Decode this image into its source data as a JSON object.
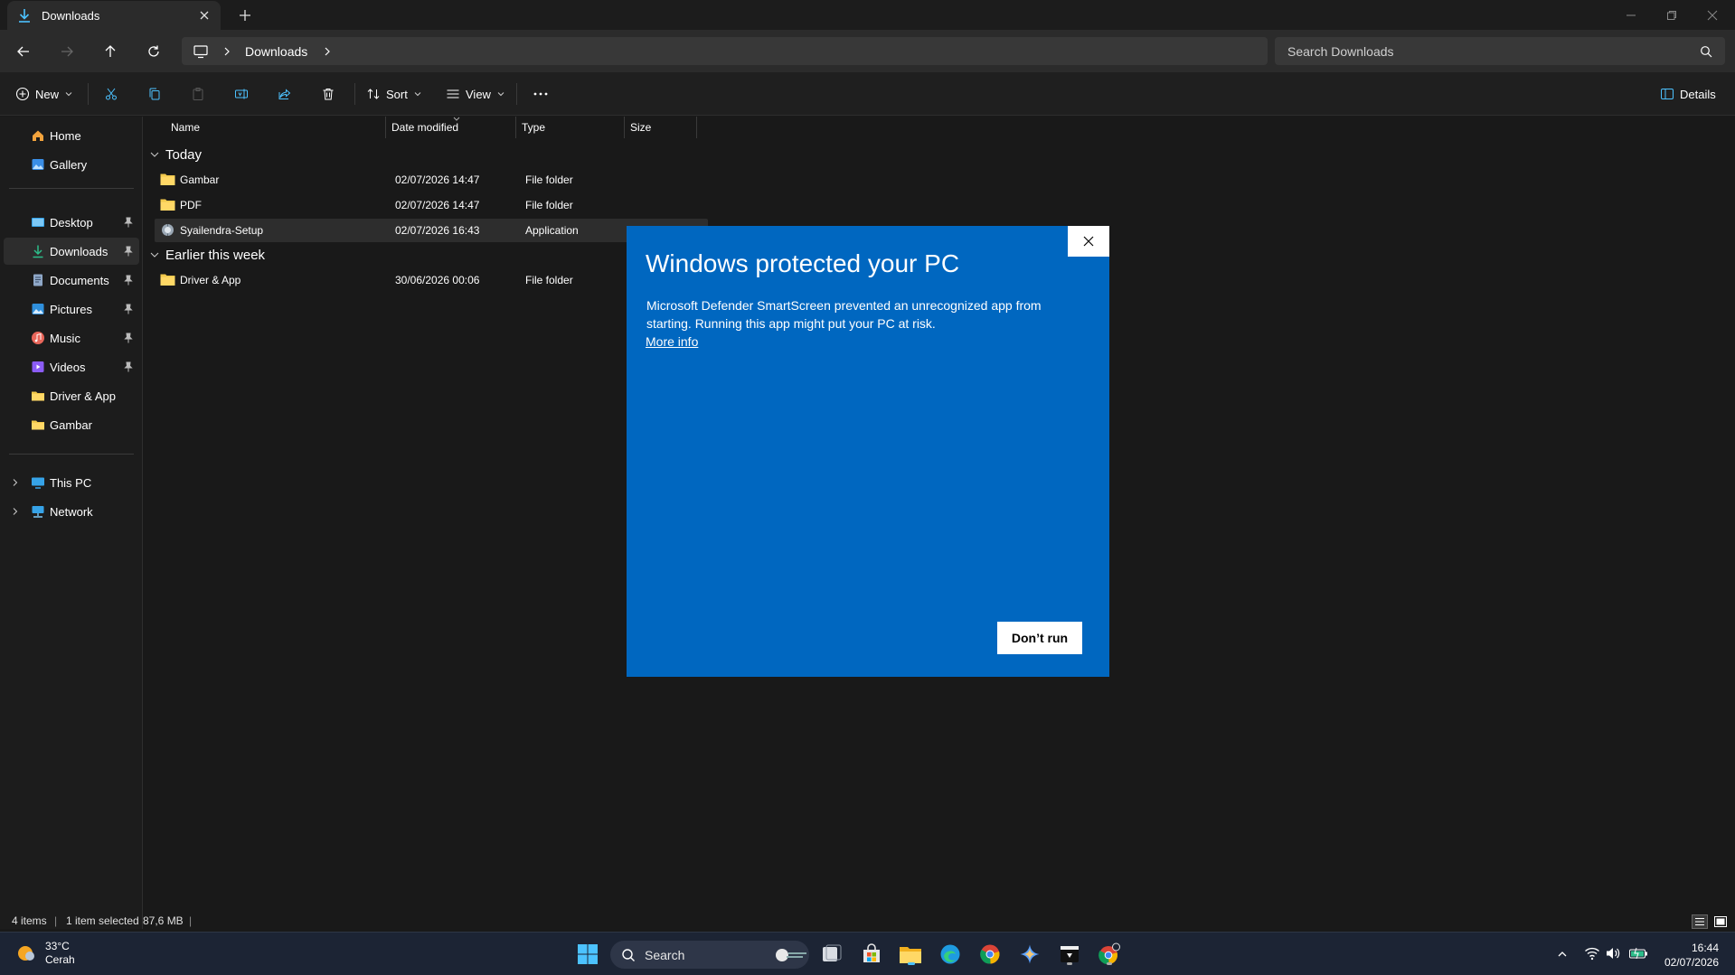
{
  "window": {
    "tab_title": "Downloads",
    "new_tab_symbol": "+",
    "controls": [
      "minimize-icon",
      "restore-icon",
      "close-icon"
    ]
  },
  "address": {
    "crumbs": [
      "Downloads"
    ],
    "search_placeholder": "Search Downloads"
  },
  "toolbar": {
    "new_label": "New",
    "sort_label": "Sort",
    "view_label": "View",
    "details_label": "Details"
  },
  "sidebar": {
    "items": [
      {
        "label": "Home",
        "icon": "home-icon",
        "pinned": false
      },
      {
        "label": "Gallery",
        "icon": "gallery-icon",
        "pinned": false
      },
      {
        "label": "Desktop",
        "icon": "desktop-icon",
        "pinned": true
      },
      {
        "label": "Downloads",
        "icon": "download-icon",
        "pinned": true,
        "selected": true
      },
      {
        "label": "Documents",
        "icon": "documents-icon",
        "pinned": true
      },
      {
        "label": "Pictures",
        "icon": "pictures-icon",
        "pinned": true
      },
      {
        "label": "Music",
        "icon": "music-icon",
        "pinned": true
      },
      {
        "label": "Videos",
        "icon": "videos-icon",
        "pinned": true
      },
      {
        "label": "Driver & App",
        "icon": "folder-icon",
        "pinned": false
      },
      {
        "label": "Gambar",
        "icon": "folder-icon",
        "pinned": false
      }
    ],
    "locations": [
      {
        "label": "This PC",
        "icon": "pc-icon"
      },
      {
        "label": "Network",
        "icon": "network-icon"
      }
    ]
  },
  "columns": [
    "Name",
    "Date modified",
    "Type",
    "Size"
  ],
  "groups": [
    {
      "title": "Today",
      "rows": [
        {
          "name": "Gambar",
          "date": "02/07/2026 14:47",
          "type": "File folder",
          "size": "",
          "icon": "folder-icon"
        },
        {
          "name": "PDF",
          "date": "02/07/2026 14:47",
          "type": "File folder",
          "size": "",
          "icon": "folder-icon"
        },
        {
          "name": "Syailendra-Setup",
          "date": "02/07/2026 16:43",
          "type": "Application",
          "size": "",
          "icon": "setup-app-icon",
          "selected": true
        }
      ]
    },
    {
      "title": "Earlier this week",
      "rows": [
        {
          "name": "Driver & App",
          "date": "30/06/2026 00:06",
          "type": "File folder",
          "size": "",
          "icon": "folder-icon"
        }
      ]
    }
  ],
  "status": {
    "count": "4 items",
    "selected": "1 item selected",
    "size": "87,6 MB"
  },
  "dialog": {
    "title": "Windows protected your PC",
    "message": "Microsoft Defender SmartScreen prevented an unrecognized app from starting. Running this app might put your PC at risk.",
    "link": "More info",
    "button": "Don’t run"
  },
  "taskbar": {
    "weather_temp": "33°C",
    "weather_desc": "Cerah",
    "search_label": "Search",
    "time": "16:44",
    "date": "02/07/2026",
    "apps": [
      "task-view-icon",
      "store-icon",
      "file-explorer-icon",
      "edge-icon",
      "chrome-icon",
      "copilot-icon",
      "terminal-app-icon",
      "chrome-profile-icon"
    ]
  },
  "colors": {
    "dialog_blue": "#0067c0",
    "folder_yellow": "#f2c94c",
    "accent_teal": "#4cc2ff"
  }
}
